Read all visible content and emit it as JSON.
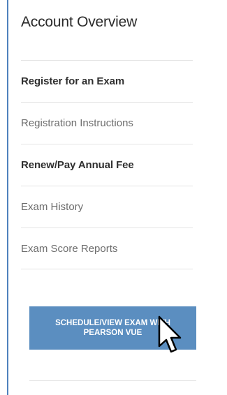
{
  "sidebar": {
    "title": "Account Overview",
    "items": [
      {
        "label": "Register for an Exam",
        "style": "dark"
      },
      {
        "label": "Registration Instructions",
        "style": "light"
      },
      {
        "label": "Renew/Pay Annual Fee",
        "style": "dark"
      },
      {
        "label": "Exam History",
        "style": "light"
      },
      {
        "label": "Exam Score Reports",
        "style": "light"
      }
    ],
    "cta_label": "SCHEDULE/VIEW EXAM WITH PEARSON VUE"
  },
  "colors": {
    "accent": "#4f81bd",
    "button": "#5b8ec0"
  },
  "icons": {
    "cursor": "mouse-pointer-icon"
  }
}
